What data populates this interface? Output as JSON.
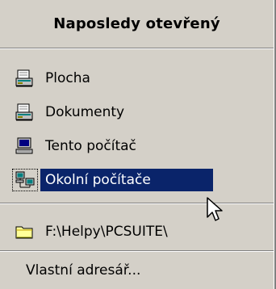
{
  "menu": {
    "header": "Naposledy otevřený",
    "items": [
      {
        "label": "Plocha",
        "icon": "desktop-icon"
      },
      {
        "label": "Dokumenty",
        "icon": "documents-icon"
      },
      {
        "label": "Tento počítač",
        "icon": "computer-icon"
      },
      {
        "label": "Okolní počítače",
        "icon": "network-icon",
        "selected": true
      }
    ],
    "path_item": {
      "label": "F:\\Helpy\\PCSUITE\\",
      "icon": "folder-icon"
    },
    "custom_item": {
      "label": "Vlastní adresář..."
    }
  },
  "colors": {
    "menu_bg": "#d4d0c8",
    "highlight": "#0a246a",
    "highlight_text": "#ffffff"
  }
}
